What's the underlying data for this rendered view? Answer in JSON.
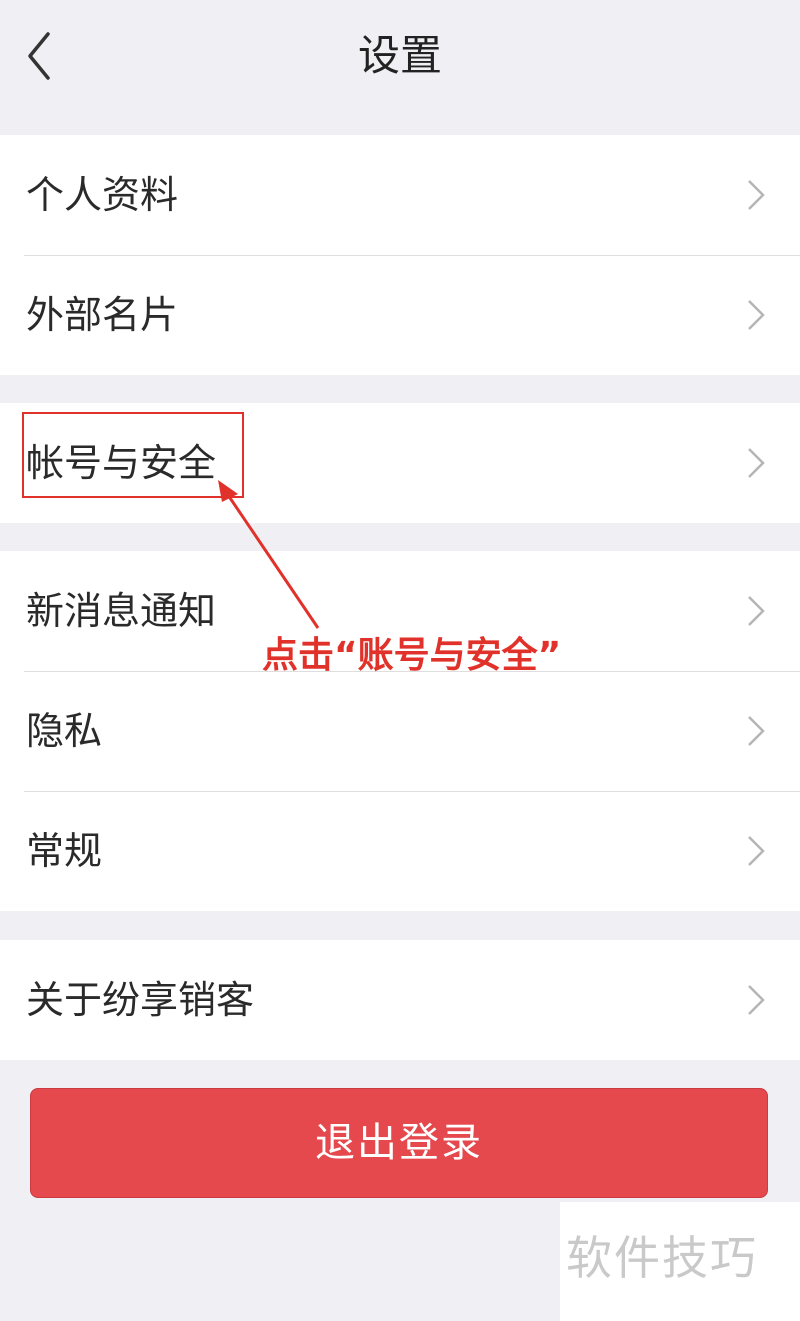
{
  "header": {
    "title": "设置",
    "back_icon": "chevron-left-icon"
  },
  "groups": [
    {
      "items": [
        {
          "label": "个人资料"
        },
        {
          "label": "外部名片"
        }
      ]
    },
    {
      "items": [
        {
          "label": "帐号与安全"
        }
      ]
    },
    {
      "items": [
        {
          "label": "新消息通知"
        },
        {
          "label": "隐私"
        },
        {
          "label": "常规"
        }
      ]
    },
    {
      "items": [
        {
          "label": "关于纷享销客"
        }
      ]
    }
  ],
  "logout": {
    "label": "退出登录",
    "color": "#e5484d"
  },
  "annotation": {
    "text": "点击“账号与安全”",
    "color": "#e0322a"
  },
  "watermark": {
    "text": "软件技巧"
  }
}
